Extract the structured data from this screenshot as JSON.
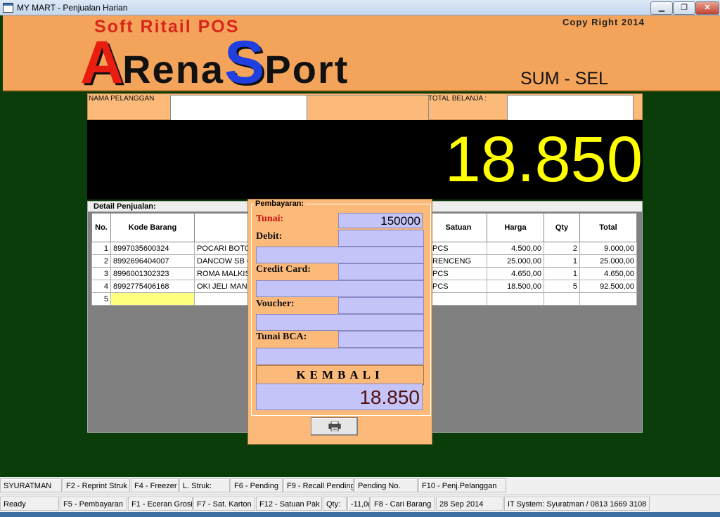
{
  "window": {
    "title": "MY MART - Penjualan Harian",
    "minimize_label": "▁",
    "maximize_label": "❐",
    "close_label": "✕"
  },
  "banner": {
    "subtitle": "Soft Ritail POS",
    "copyright": "Copy Right 2014",
    "brand_letter_1": "A",
    "brand_word_1": "Rena",
    "brand_letter_2": "S",
    "brand_word_2": "Port",
    "region": "SUM - SEL"
  },
  "customer": {
    "name_label": "NAMA PELANGGAN",
    "name_value": "",
    "extra_value": "",
    "total_label": "TOTAL BELANJA :",
    "total_value": ""
  },
  "display": {
    "amount": "18.850"
  },
  "detail": {
    "legend": "Detail Penjualan:",
    "columns": [
      "No.",
      "Kode Barang",
      "",
      "Satuan",
      "Harga",
      "Qty",
      "Total"
    ],
    "rows": [
      {
        "no": "1",
        "kode": "8997035600324",
        "nama": "POCARI BOTO",
        "satuan": "PCS",
        "harga": "4.500,00",
        "qty": "2",
        "total": "9.000,00"
      },
      {
        "no": "2",
        "kode": "8992696404007",
        "nama": "DANCOW SB C",
        "satuan": "RENCENG",
        "harga": "25.000,00",
        "qty": "1",
        "total": "25.000,00"
      },
      {
        "no": "3",
        "kode": "8996001302323",
        "nama": " ROMA MALKIS",
        "satuan": "PCS",
        "harga": "4.650,00",
        "qty": "1",
        "total": "4.650,00"
      },
      {
        "no": "4",
        "kode": "8992775406168",
        "nama": "OKI JELI MANG",
        "satuan": "PCS",
        "harga": "18.500,00",
        "qty": "5",
        "total": "92.500,00"
      },
      {
        "no": "5",
        "kode": "",
        "nama": "",
        "satuan": "",
        "harga": "",
        "qty": "",
        "total": ""
      }
    ]
  },
  "payment": {
    "title": "Pembayaran:",
    "tunai_label": "Tunai:",
    "tunai_value": "150000",
    "debit_label": "Debit:",
    "credit_label": "Credit Card:",
    "voucher_label": "Voucher:",
    "bca_label": "Tunai BCA:",
    "kembali_label": "KEMBALI",
    "kembali_value": "18.850",
    "print_icon": "printer-icon"
  },
  "status1": [
    "SYURATMAN",
    "F2 - Reprint Struk",
    "F4 - Freezer",
    "L. Struk:",
    "F6 - Pending",
    "F9 - Recall Pending",
    "Pending No.",
    "F10 - Penj.Pelanggan"
  ],
  "status2": [
    "Ready",
    "F5  - Pembayaran",
    "F1 - Eceran Grosir",
    "F7 - Sat. Karton",
    "F12 - Satuan Pak",
    "Qty:",
    "-11,0(",
    "F8 - Cari Barang",
    "28 Sep 2014",
    "IT System: Syuratman / 0813 1669 3108"
  ],
  "colors": {
    "banner": "#f4a45a",
    "display_text": "#ffff00",
    "payment_bg": "#fbb97a",
    "payment_field": "#c5c4f8",
    "background": "#0b3d0b"
  }
}
